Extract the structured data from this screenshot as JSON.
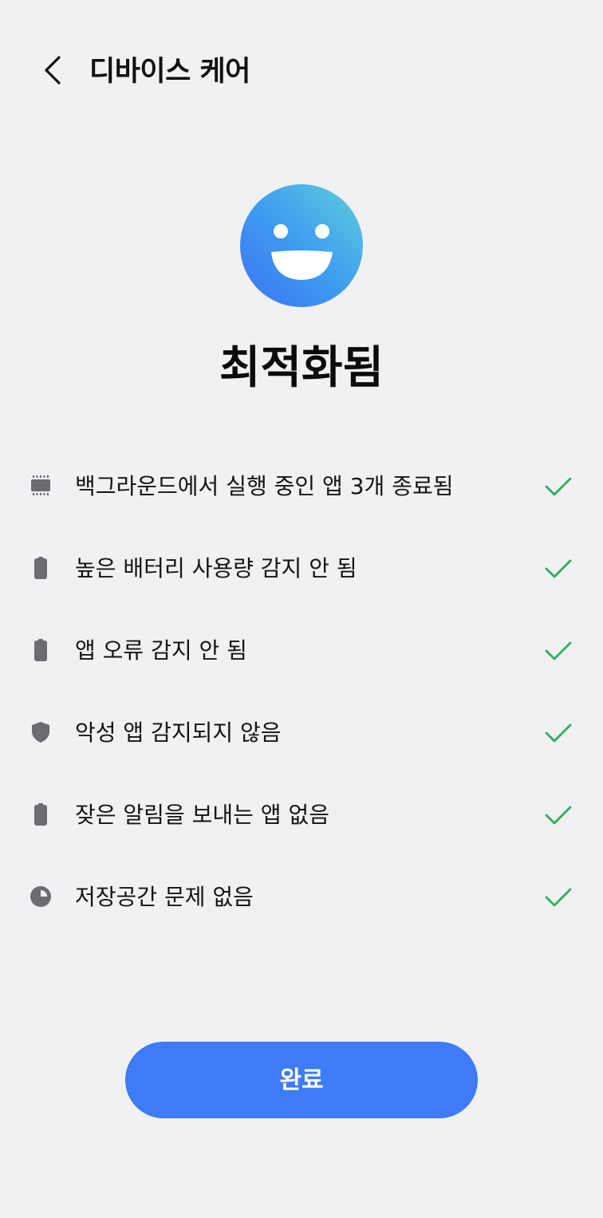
{
  "header": {
    "title": "디바이스 케어",
    "back_icon": "chevron-left-icon"
  },
  "result": {
    "icon": "smiley-face-icon",
    "title": "최적화됨"
  },
  "checklist": [
    {
      "icon": "memory-chip-icon",
      "label": "백그라운드에서 실행 중인 앱 3개 종료됨",
      "status": "check-icon"
    },
    {
      "icon": "battery-icon",
      "label": "높은 배터리 사용량 감지 안 됨",
      "status": "check-icon"
    },
    {
      "icon": "battery-icon",
      "label": "앱 오류 감지 안 됨",
      "status": "check-icon"
    },
    {
      "icon": "shield-icon",
      "label": "악성 앱 감지되지 않음",
      "status": "check-icon"
    },
    {
      "icon": "battery-icon",
      "label": "잦은 알림을 보내는 앱 없음",
      "status": "check-icon"
    },
    {
      "icon": "storage-pie-icon",
      "label": "저장공간 문제 없음",
      "status": "check-icon"
    }
  ],
  "footer": {
    "done_label": "완료"
  },
  "colors": {
    "background": "#f1f1f4",
    "accent": "#3d7bf7",
    "check": "#2fae5b",
    "icon_gray": "#6b6b70"
  }
}
